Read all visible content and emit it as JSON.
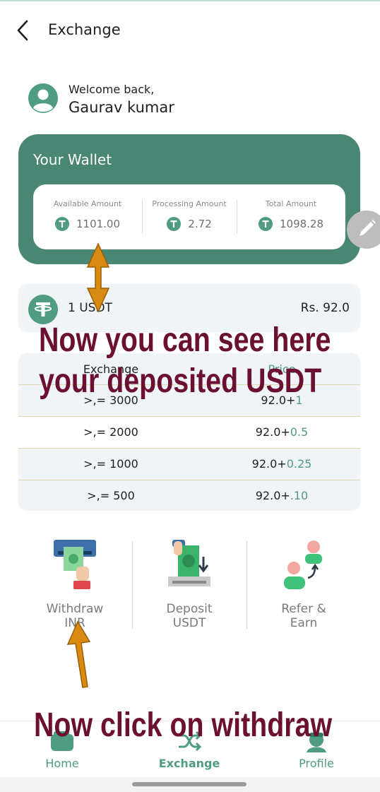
{
  "header": {
    "title": "Exchange"
  },
  "welcome": {
    "greeting": "Welcome back,",
    "name": "Gaurav kumar"
  },
  "wallet": {
    "title": "Your Wallet",
    "available_label": "Available Amount",
    "available_value": "1101.00",
    "processing_label": "Processing Amount",
    "processing_value": "2.72",
    "total_label": "Total Amount",
    "total_value": "1098.28"
  },
  "rate": {
    "label": "1 USDT",
    "price": "Rs. 92.0"
  },
  "table": {
    "headers": [
      "Exchange",
      "Price"
    ],
    "rows": [
      {
        "exchange": ">,= 3000",
        "base": "92.0+",
        "bonus": "1"
      },
      {
        "exchange": ">,= 2000",
        "base": "92.0+",
        "bonus": "0.5"
      },
      {
        "exchange": ">,= 1000",
        "base": "92.0+",
        "bonus": "0.25"
      },
      {
        "exchange": ">,= 500",
        "base": "92.0+",
        "bonus": ".10"
      }
    ]
  },
  "actions": [
    {
      "line1": "Withdraw",
      "line2": "INR"
    },
    {
      "line1": "Deposit",
      "line2": "USDT"
    },
    {
      "line1": "Refer &",
      "line2": "Earn"
    }
  ],
  "nav": [
    {
      "label": "Home"
    },
    {
      "label": "Exchange"
    },
    {
      "label": "Profile"
    }
  ],
  "annotations": {
    "line1": "Now you can see here",
    "line2": "your deposited USDT",
    "line3": "Now click on withdraw"
  },
  "colors": {
    "brand": "#4a8674",
    "accent": "#4f9c83",
    "annotation_text": "#6b1030",
    "annotation_arrow": "#d98a12"
  }
}
